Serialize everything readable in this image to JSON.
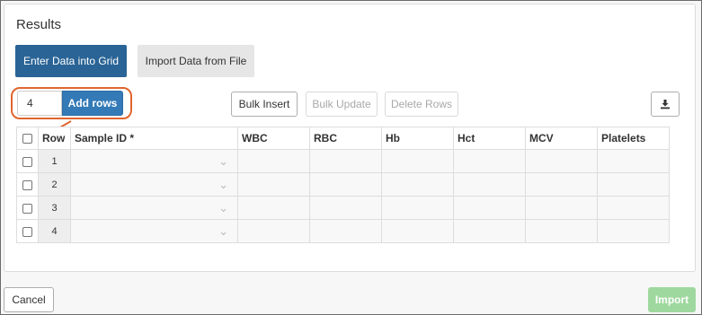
{
  "panel": {
    "title": "Results"
  },
  "tabs": {
    "enter_grid": "Enter Data into Grid",
    "import_file": "Import Data from File"
  },
  "add_rows": {
    "count": "4",
    "button_label": "Add rows"
  },
  "toolbar": {
    "bulk_insert": "Bulk Insert",
    "bulk_update": "Bulk Update",
    "delete_rows": "Delete Rows",
    "export_icon": "download-icon"
  },
  "grid": {
    "columns": [
      "Row",
      "Sample ID  *",
      "WBC",
      "RBC",
      "Hb",
      "Hct",
      "MCV",
      "Platelets"
    ],
    "rows": [
      "1",
      "2",
      "3",
      "4"
    ]
  },
  "footer": {
    "cancel": "Cancel",
    "import": "Import"
  },
  "colors": {
    "active_tab": "#2a6496",
    "add_rows_button": "#337ab7",
    "highlight": "#e0652e",
    "import_disabled": "#9fd89f"
  }
}
